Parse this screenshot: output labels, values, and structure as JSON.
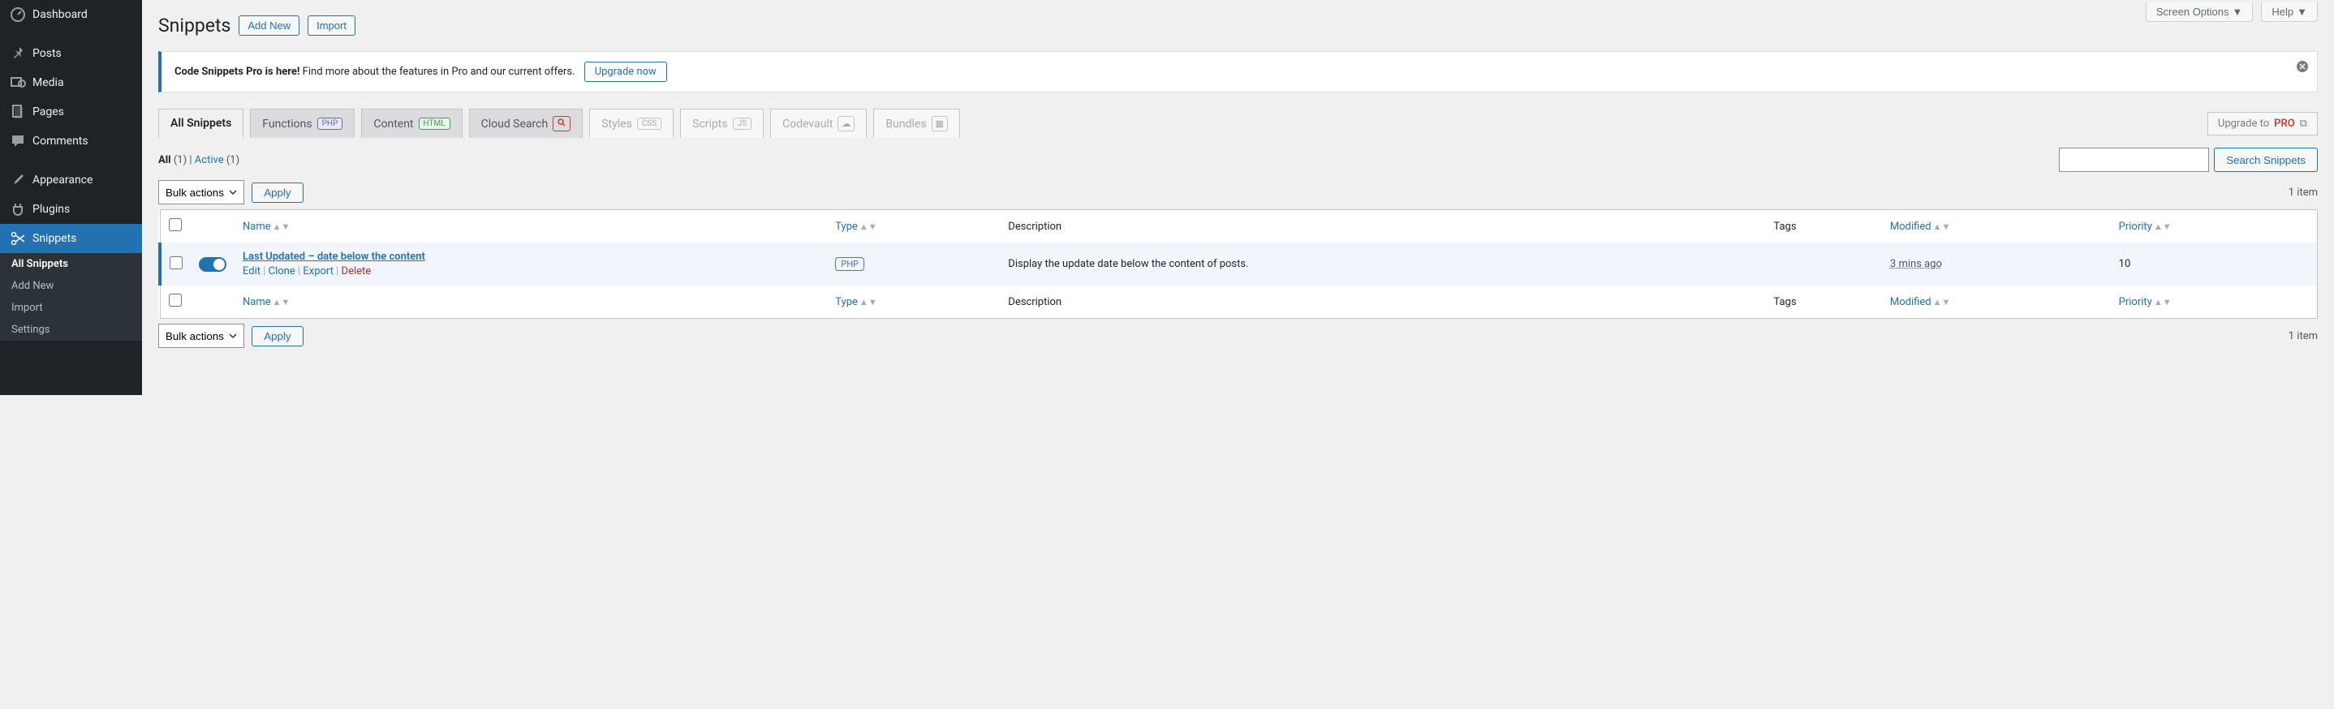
{
  "sidebar": {
    "items": [
      {
        "label": "Dashboard",
        "icon": "dashboard"
      },
      {
        "label": "Posts",
        "icon": "pin"
      },
      {
        "label": "Media",
        "icon": "media"
      },
      {
        "label": "Pages",
        "icon": "pages"
      },
      {
        "label": "Comments",
        "icon": "comment"
      },
      {
        "label": "Appearance",
        "icon": "brush"
      },
      {
        "label": "Plugins",
        "icon": "plug"
      },
      {
        "label": "Snippets",
        "icon": "scissors",
        "current": true
      }
    ],
    "submenu": [
      {
        "label": "All Snippets",
        "current": true
      },
      {
        "label": "Add New"
      },
      {
        "label": "Import"
      },
      {
        "label": "Settings"
      }
    ]
  },
  "top": {
    "screen_options": "Screen Options",
    "help": "Help"
  },
  "header": {
    "title": "Snippets",
    "add_new": "Add New",
    "import": "Import"
  },
  "notice": {
    "bold": "Code Snippets Pro is here!",
    "text": " Find more about the features in Pro and our current offers. ",
    "link": "Upgrade now"
  },
  "tabs": [
    {
      "label": "All Snippets",
      "active": true
    },
    {
      "label": "Functions",
      "badge": "PHP",
      "badge_class": "php"
    },
    {
      "label": "Content",
      "badge": "HTML",
      "badge_class": "html"
    },
    {
      "label": "Cloud Search",
      "badge_icon": "search"
    },
    {
      "label": "Styles",
      "badge": "CSS",
      "badge_class": "css",
      "disabled": true
    },
    {
      "label": "Scripts",
      "badge": "JS",
      "badge_class": "js",
      "disabled": true
    },
    {
      "label": "Codevault",
      "icon_box": "cloud",
      "disabled": true
    },
    {
      "label": "Bundles",
      "icon_box": "grid",
      "disabled": true
    }
  ],
  "upgrade_tab": {
    "text": "Upgrade to ",
    "badge": "PRO"
  },
  "filters": {
    "all": "All",
    "all_count": "(1)",
    "sep": " | ",
    "active": "Active",
    "active_count": "(1)"
  },
  "search": {
    "button": "Search Snippets"
  },
  "bulk": {
    "label": "Bulk actions",
    "apply": "Apply"
  },
  "item_count": "1 item",
  "columns": {
    "name": "Name",
    "type": "Type",
    "description": "Description",
    "tags": "Tags",
    "modified": "Modified",
    "priority": "Priority"
  },
  "row": {
    "title": "Last Updated – date below the content",
    "actions": {
      "edit": "Edit",
      "clone": "Clone",
      "export": "Export",
      "delete": "Delete"
    },
    "type": "PHP",
    "description": "Display the update date below the content of posts.",
    "modified": "3 mins ago",
    "priority": "10"
  }
}
